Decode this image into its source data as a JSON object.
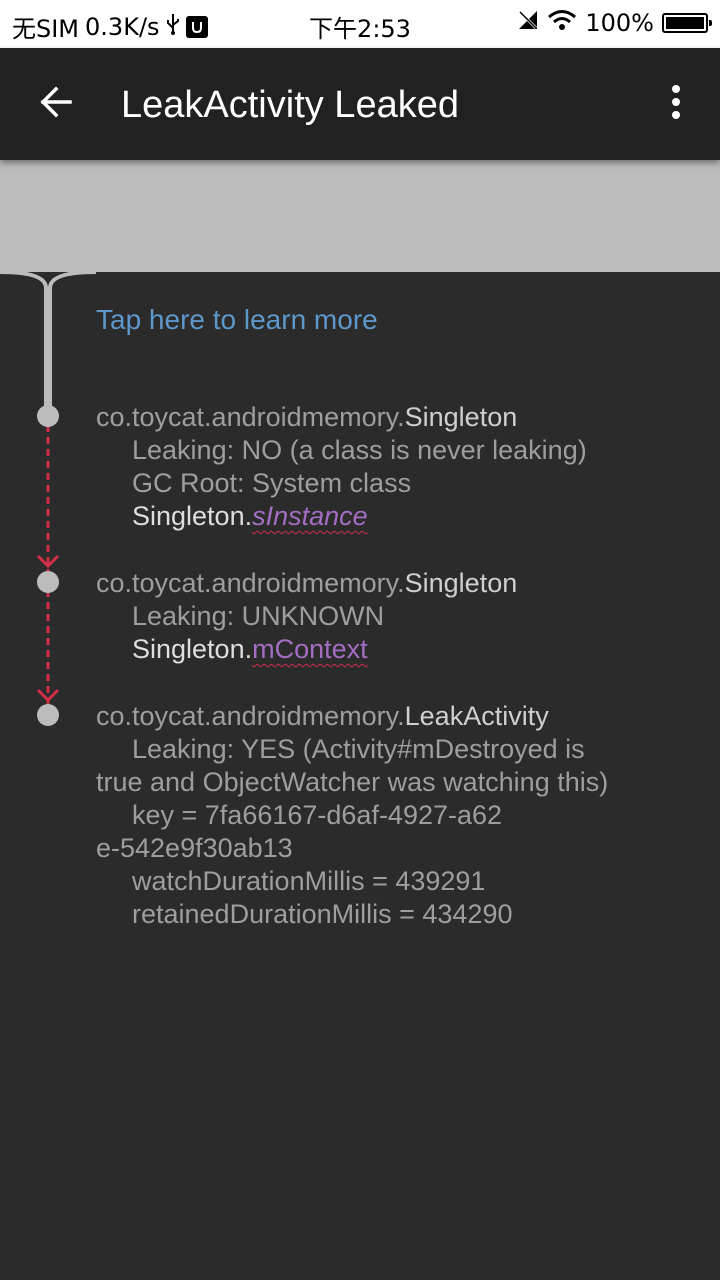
{
  "status_bar": {
    "carrier": "无SIM",
    "speed": "0.3K/s",
    "time": "下午2:53",
    "battery_percent": "100%",
    "battery_level": 1.0
  },
  "app_bar": {
    "title": "LeakActivity Leaked",
    "back_icon": "arrow-left-icon",
    "menu_icon": "more-vert-icon"
  },
  "content": {
    "learn_more": "Tap here to learn more",
    "nodes": [
      {
        "package": "co.toycat.androidmemory.",
        "class_name": "Singleton",
        "leaking": "Leaking: NO (a class is never leaking)",
        "gc_root": "GC Root: System class",
        "ref_owner": "Singleton.",
        "ref_field": "sInstance"
      },
      {
        "package": "co.toycat.androidmemory.",
        "class_name": "Singleton",
        "leaking": "Leaking: UNKNOWN",
        "ref_owner": "Singleton.",
        "ref_field": "mContext"
      },
      {
        "package": "co.toycat.androidmemory.",
        "class_name": "LeakActivity",
        "leaking": "Leaking: YES (Activity#mDestroyed is true and ObjectWatcher was watching this)",
        "key": "key = 7fa66167-d6af-4927-a62e-542e9f30ab13",
        "watch_duration": "watchDurationMillis = 439291",
        "retained_duration": "retainedDurationMillis = 434290"
      }
    ]
  },
  "colors": {
    "app_bar_bg": "#212121",
    "content_bg": "#2b2b2b",
    "band_bg": "#bcbcbc",
    "link": "#5e97c9",
    "field": "#a36ec1",
    "leak_path": "#d22f45"
  }
}
